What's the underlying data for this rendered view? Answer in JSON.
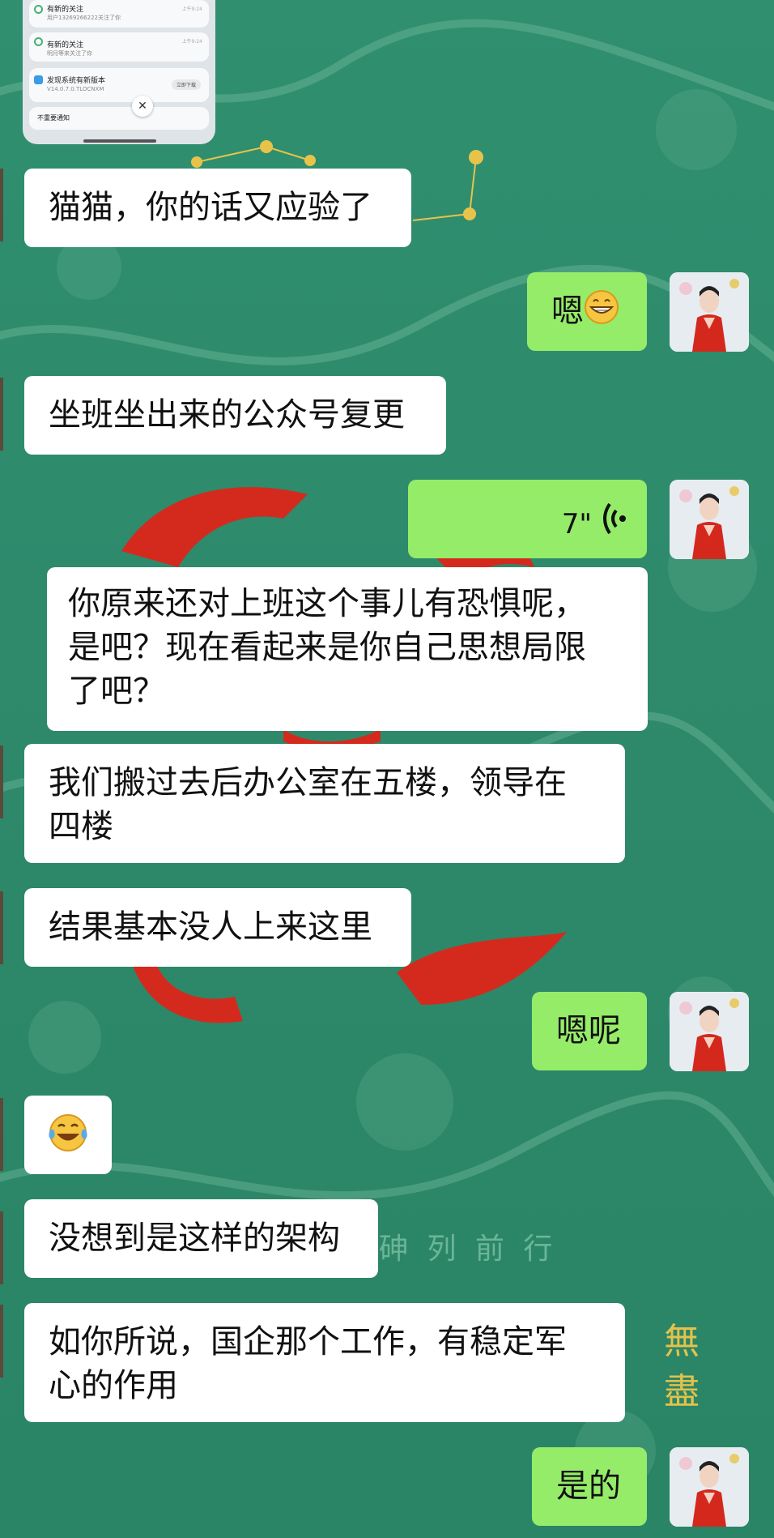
{
  "notifications": {
    "items": [
      {
        "title": "有新的关注",
        "subtitle": "用户13269266222关注了你",
        "time": "上午9:24"
      },
      {
        "title": "有新的关注",
        "subtitle": "明月等来关注了你",
        "time": "上午9:24"
      },
      {
        "title": "发现系统有新版本",
        "subtitle": "V14.0.7.0.TLOCNXM",
        "action": "立即下载"
      }
    ],
    "dismiss_label": "不重要通知",
    "close_icon": "close-icon"
  },
  "background": {
    "watermark_text": "砷 列 前 行",
    "seal_text": "無 盡"
  },
  "messages": [
    {
      "side": "left",
      "text": "猫猫，你的话又应验了"
    },
    {
      "side": "right",
      "text": "嗯",
      "emoji": "grinning-face-icon"
    },
    {
      "side": "left",
      "text": "坐班坐出来的公众号复更"
    },
    {
      "side": "right",
      "type": "voice",
      "duration": "7\""
    },
    {
      "side": "left",
      "text_lines": [
        "你原来还对上班这个事儿有恐惧呢，",
        "是吧？现在看起来是你自己思想局限",
        "了吧？"
      ]
    },
    {
      "side": "left",
      "text_lines": [
        "我们搬过去后办公室在五楼，领导在",
        "四楼"
      ]
    },
    {
      "side": "left",
      "text": "结果基本没人上来这里"
    },
    {
      "side": "right",
      "text": "嗯呢"
    },
    {
      "side": "left",
      "type": "emoji",
      "emoji": "tears-of-joy-icon"
    },
    {
      "side": "left",
      "text": "没想到是这样的架构"
    },
    {
      "side": "left",
      "text_lines": [
        "如你所说，国企那个工作，有稳定军",
        "心的作用"
      ]
    },
    {
      "side": "right",
      "text": "是的"
    }
  ],
  "colors": {
    "sent_bubble": "#95ec69",
    "received_bubble": "#ffffff",
    "background": "#2e8a6b",
    "accent_red": "#d42a1e"
  }
}
